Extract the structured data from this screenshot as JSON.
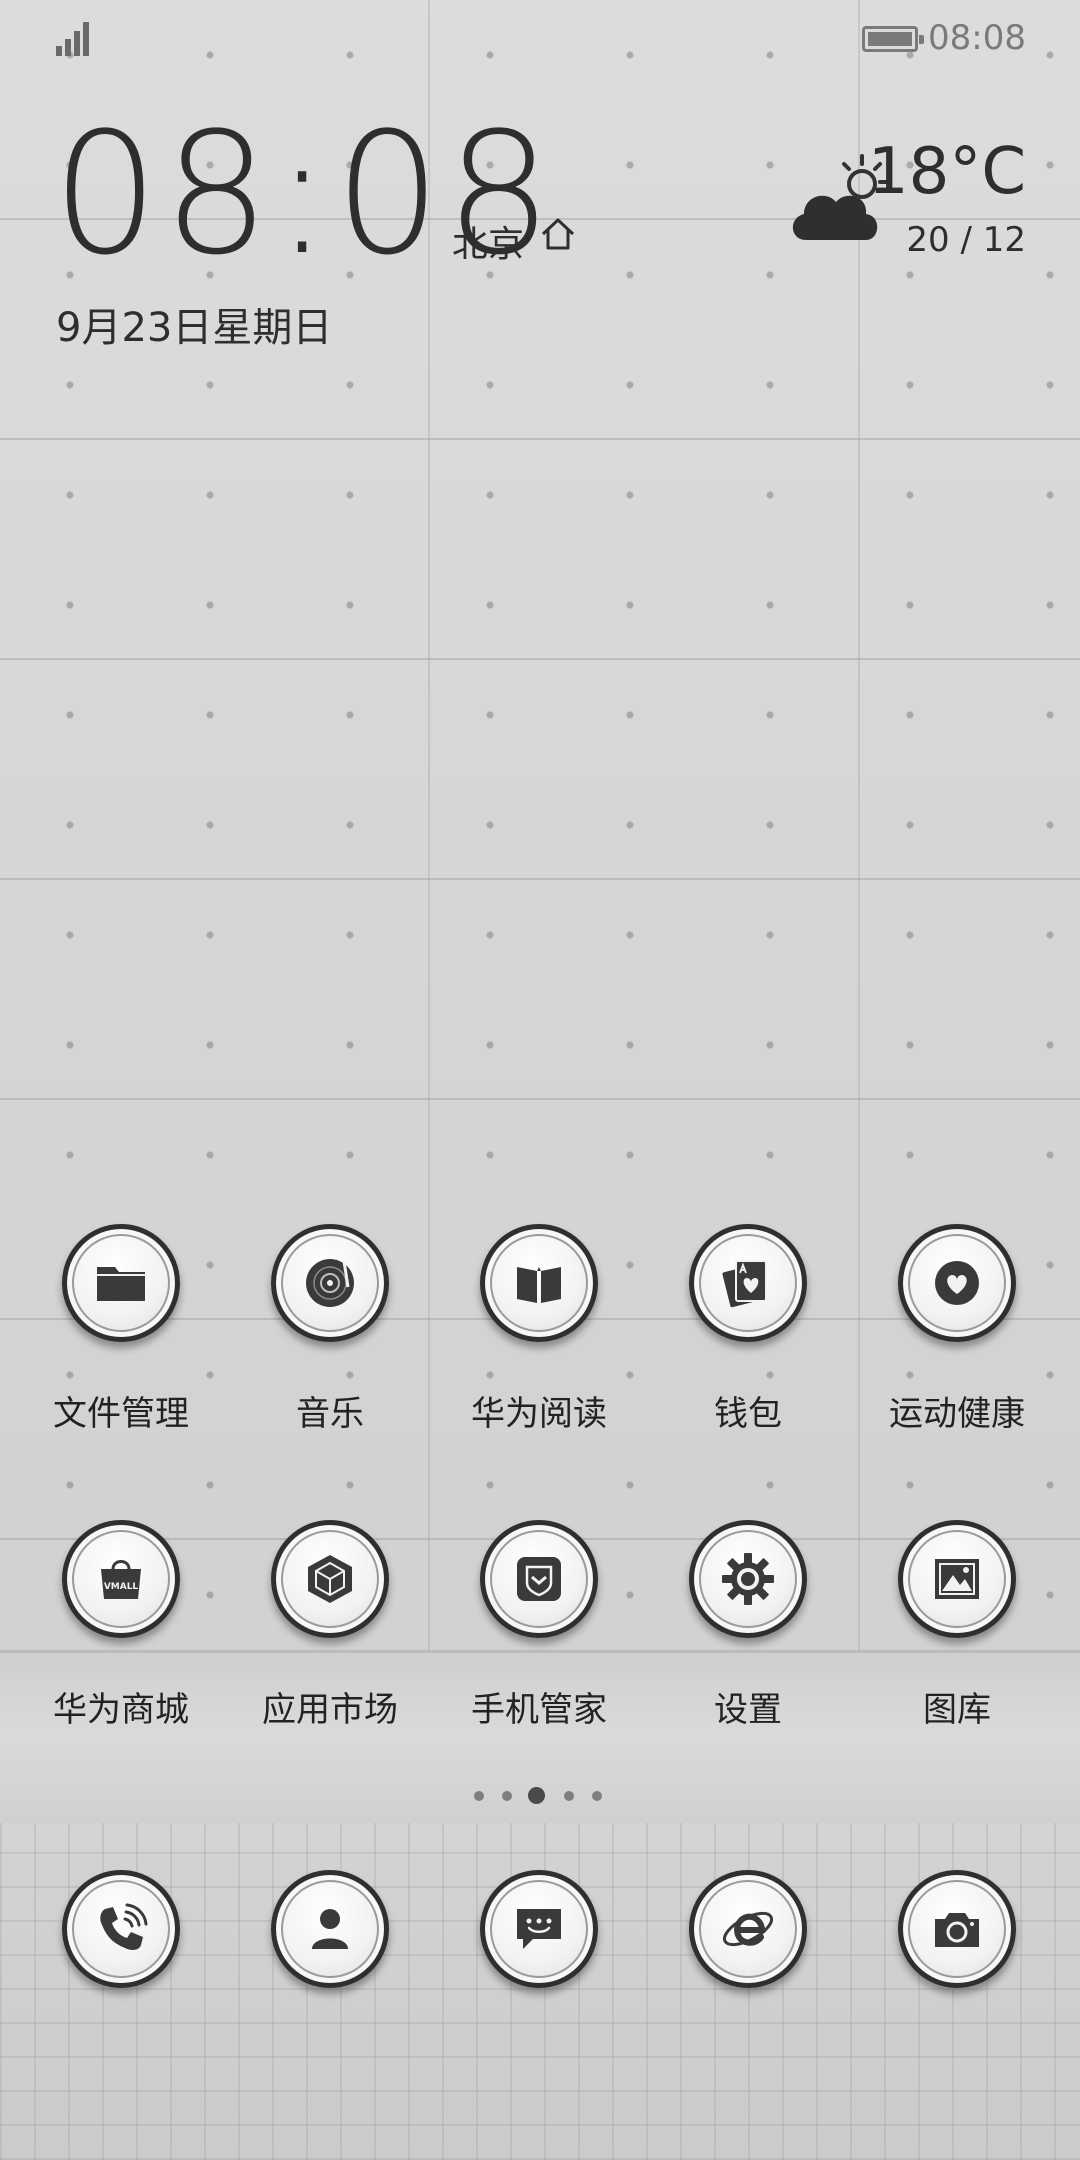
{
  "status_bar": {
    "time": "08:08",
    "battery_level": 1.0,
    "signal_bars": 4
  },
  "clock_widget": {
    "time": "08:08",
    "city": "北京",
    "date": "9月23日星期日"
  },
  "weather": {
    "temperature": "18°C",
    "range": "20 / 12",
    "condition_icon": "partly-cloudy-icon"
  },
  "apps_row1": [
    {
      "label": "文件管理",
      "icon": "folder-icon"
    },
    {
      "label": "音乐",
      "icon": "music-disc-icon"
    },
    {
      "label": "华为阅读",
      "icon": "book-icon"
    },
    {
      "label": "钱包",
      "icon": "wallet-cards-icon"
    },
    {
      "label": "运动健康",
      "icon": "heart-icon"
    }
  ],
  "apps_row2": [
    {
      "label": "华为商城",
      "icon": "vmall-bag-icon",
      "icon_text": "VMALL"
    },
    {
      "label": "应用市场",
      "icon": "cube-icon"
    },
    {
      "label": "手机管家",
      "icon": "shield-check-icon"
    },
    {
      "label": "设置",
      "icon": "gear-icon"
    },
    {
      "label": "图库",
      "icon": "gallery-icon"
    }
  ],
  "page_indicator": {
    "count": 5,
    "active_index": 2
  },
  "dock": [
    {
      "icon": "phone-icon"
    },
    {
      "icon": "contacts-icon"
    },
    {
      "icon": "messages-icon"
    },
    {
      "icon": "browser-icon"
    },
    {
      "icon": "camera-icon"
    }
  ],
  "colors": {
    "text_dark": "#2e2e2e",
    "status_gray": "#7a7a7a",
    "icon_dark": "#3a3a3a"
  }
}
